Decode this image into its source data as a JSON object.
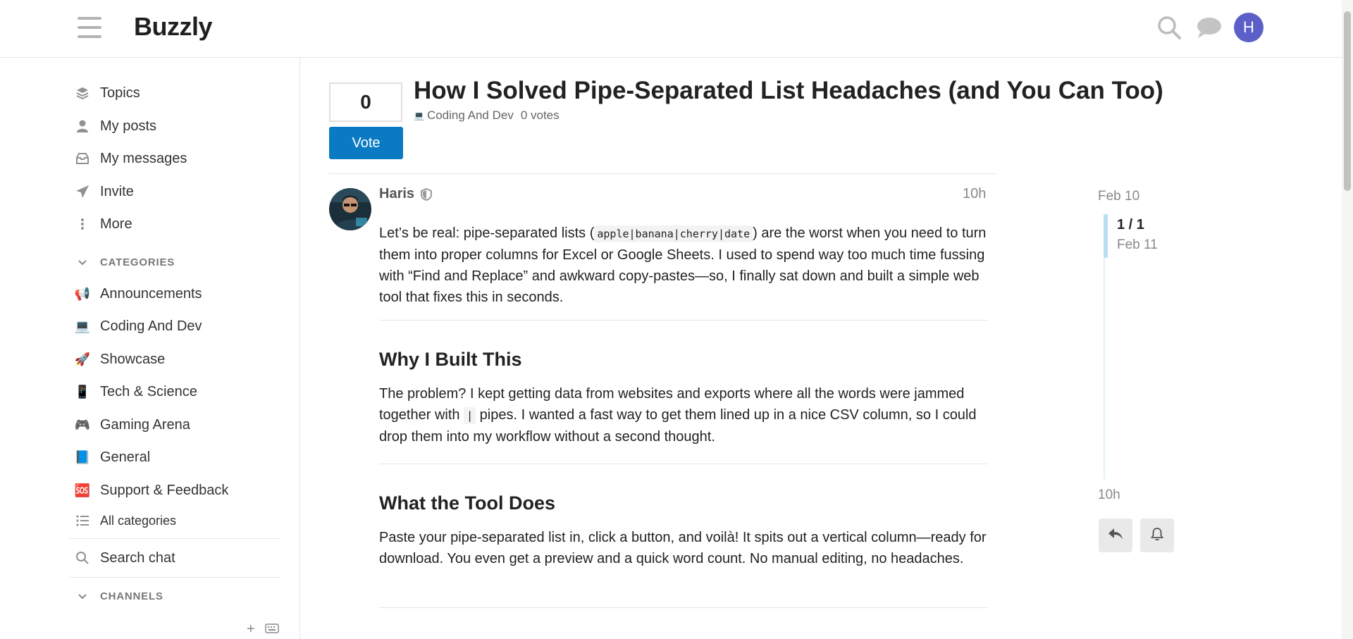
{
  "header": {
    "brand": "Buzzly",
    "avatar_letter": "H",
    "avatar_color": "#5b5fc7"
  },
  "sidebar": {
    "nav": [
      {
        "label": "Topics",
        "icon": "layers-icon"
      },
      {
        "label": "My posts",
        "icon": "user-icon"
      },
      {
        "label": "My messages",
        "icon": "inbox-icon"
      },
      {
        "label": "Invite",
        "icon": "paper-plane-icon"
      },
      {
        "label": "More",
        "icon": "vertical-ellipsis-icon"
      }
    ],
    "categories_header": "CATEGORIES",
    "categories": [
      {
        "label": "Announcements",
        "icon": "📢"
      },
      {
        "label": "Coding And Dev",
        "icon": "💻"
      },
      {
        "label": "Showcase",
        "icon": "🚀"
      },
      {
        "label": "Tech & Science",
        "icon": "📱"
      },
      {
        "label": "Gaming Arena",
        "icon": "🎮"
      },
      {
        "label": "General",
        "icon": "📘"
      },
      {
        "label": "Support & Feedback",
        "icon": "🆘"
      }
    ],
    "all_categories": "All categories",
    "search_chat": "Search chat",
    "channels_header": "CHANNELS"
  },
  "topic": {
    "vote_count": "0",
    "vote_button": "Vote",
    "title": "How I Solved Pipe-Separated List Headaches (and You Can Too)",
    "category": "Coding And Dev",
    "votes_text": "0 votes"
  },
  "post": {
    "author": "Haris",
    "time": "10h",
    "intro_a": "Let’s be real: pipe-separated lists (",
    "intro_code": "apple|banana|cherry|date",
    "intro_b": ") are the worst when you need to turn them into proper columns for Excel or Google Sheets. I used to spend way too much time fussing with “Find and Replace” and awkward copy-pastes—so, I finally sat down and built a simple web tool that fixes this in seconds.",
    "h_why": "Why I Built This",
    "why_a": "The problem? I kept getting data from websites and exports where all the words were jammed together with ",
    "why_code": "|",
    "why_b": " pipes. I wanted a fast way to get them lined up in a nice CSV column, so I could drop them into my workflow without a second thought.",
    "h_what": "What the Tool Does",
    "what": "Paste your pipe-separated list in, click a button, and voilà! It spits out a vertical column—ready for download. You even get a preview and a quick word count. No manual editing, no headaches."
  },
  "timeline": {
    "start_date": "Feb 10",
    "position": "1 / 1",
    "current_date": "Feb 11",
    "end_label": "10h"
  }
}
